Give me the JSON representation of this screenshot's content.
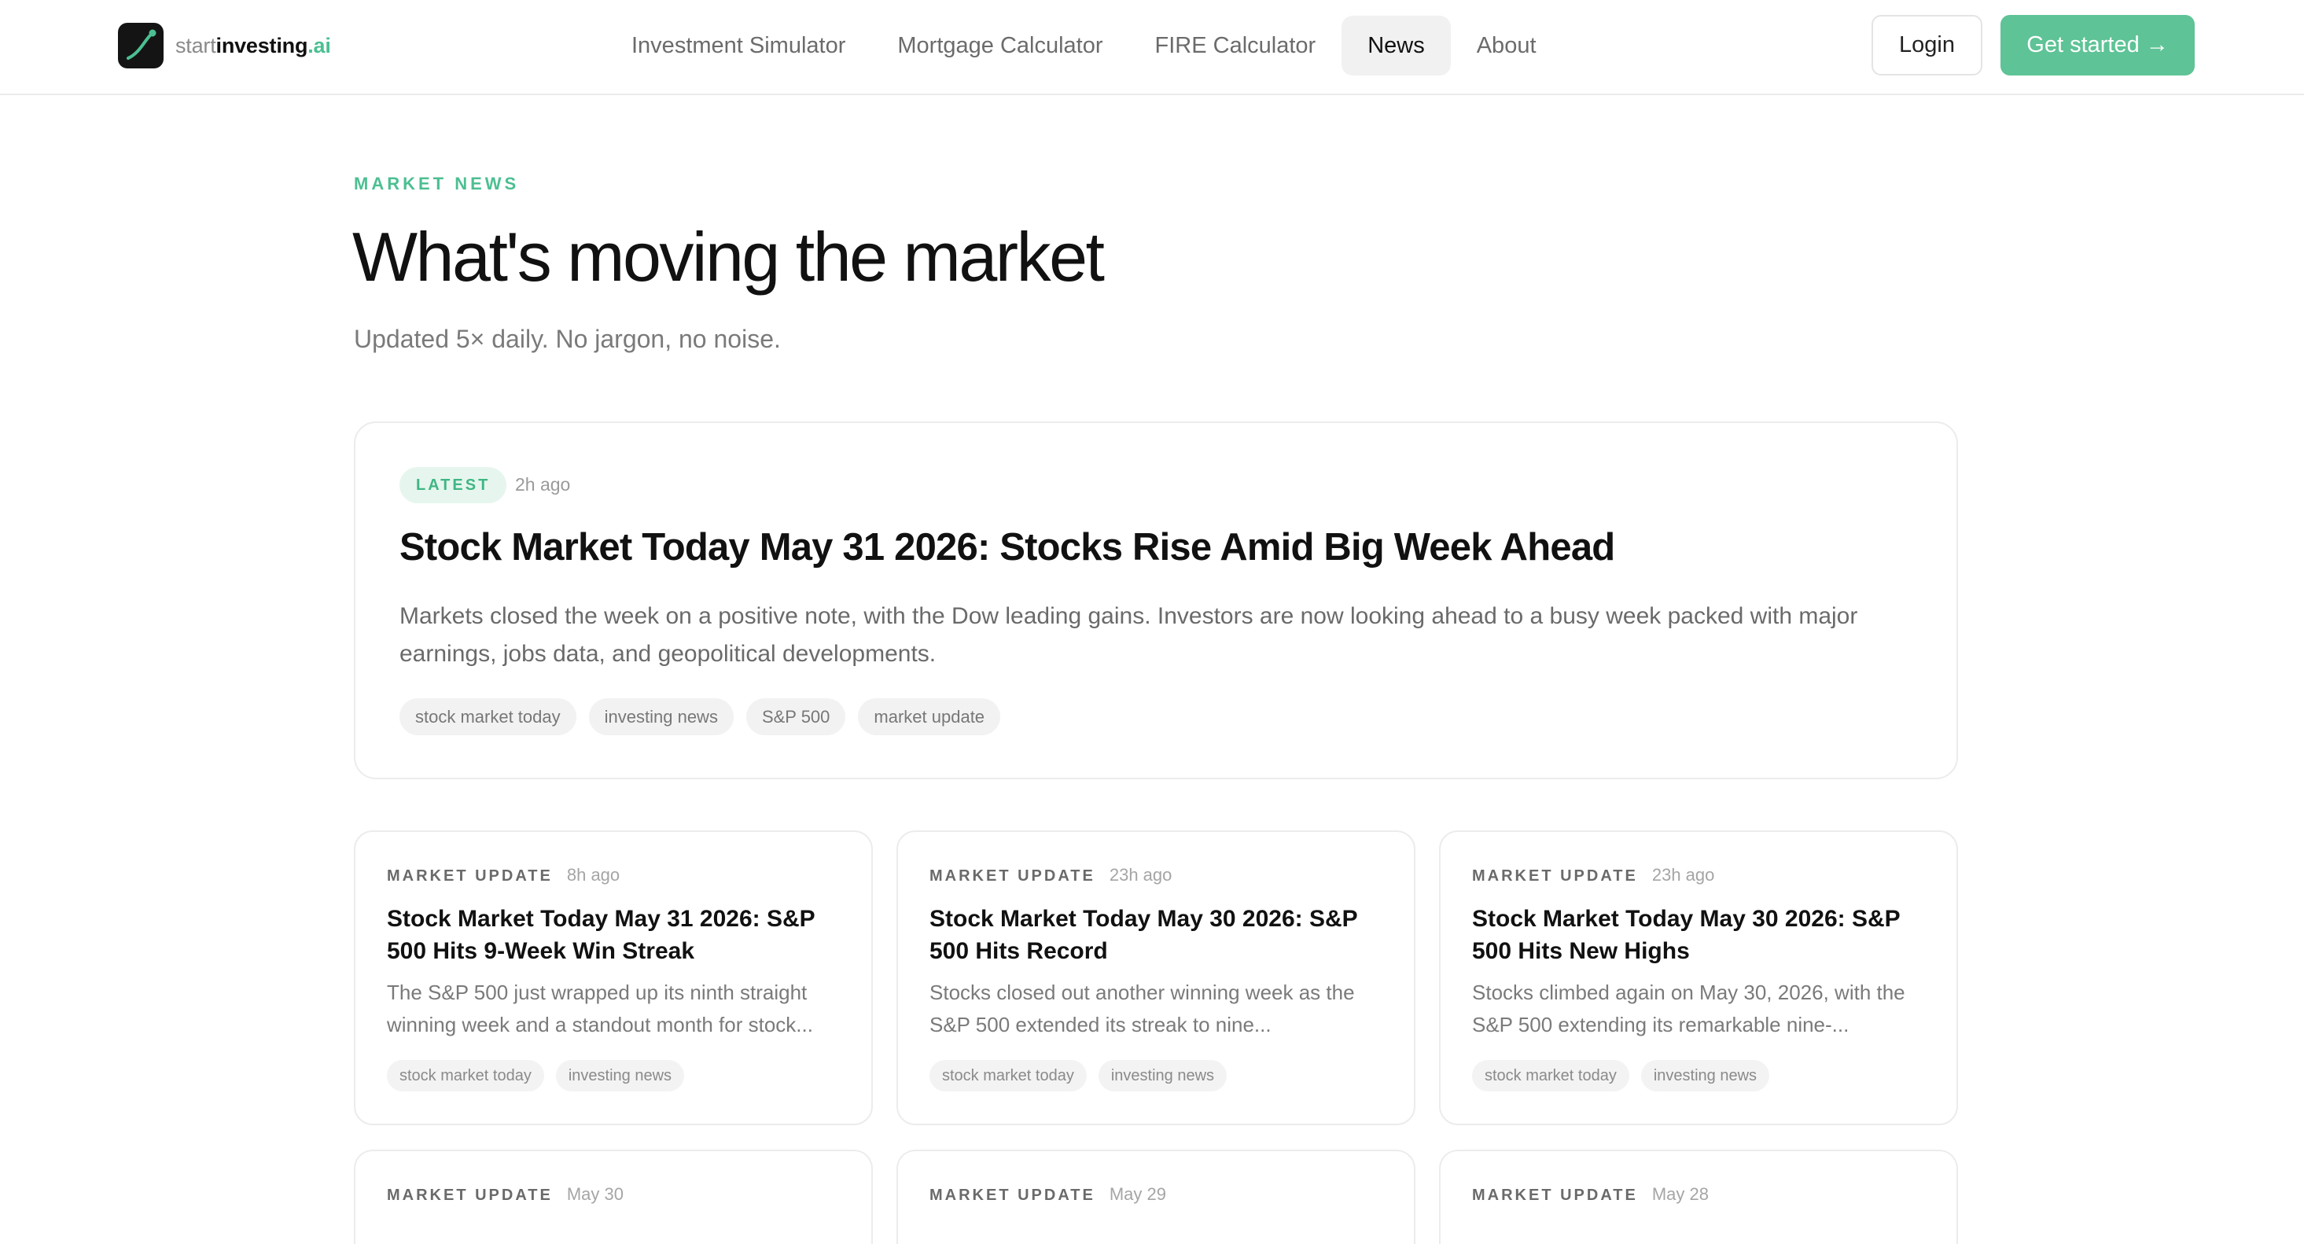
{
  "brand": {
    "part1": "start",
    "part2": "investing",
    "part3": ".ai",
    "accent": "#5ec396"
  },
  "nav": {
    "items": [
      {
        "label": "Investment Simulator"
      },
      {
        "label": "Mortgage Calculator"
      },
      {
        "label": "FIRE Calculator"
      },
      {
        "label": "News",
        "active": true
      },
      {
        "label": "About"
      }
    ],
    "login_label": "Login",
    "cta_label": "Get started",
    "cta_arrow": "→"
  },
  "hero": {
    "eyebrow": "MARKET NEWS",
    "title": "What's moving the market",
    "subtitle": "Updated 5× daily. No jargon, no noise."
  },
  "featured": {
    "badge": "LATEST",
    "time": "2h ago",
    "title": "Stock Market Today May 31 2026: Stocks Rise Amid Big Week Ahead",
    "excerpt": "Markets closed the week on a positive note, with the Dow leading gains. Investors are now looking ahead to a busy week packed with major earnings, jobs data, and geopolitical developments.",
    "tags": [
      "stock market today",
      "investing news",
      "S&P 500",
      "market update"
    ]
  },
  "cards": [
    {
      "category": "MARKET UPDATE",
      "time": "8h ago",
      "title": "Stock Market Today May 31 2026: S&P 500 Hits 9-Week Win Streak",
      "excerpt": "The S&P 500 just wrapped up its ninth straight winning week and a standout month for stock...",
      "tags": [
        "stock market today",
        "investing news"
      ]
    },
    {
      "category": "MARKET UPDATE",
      "time": "23h ago",
      "title": "Stock Market Today May 30 2026: S&P 500 Hits Record",
      "excerpt": "Stocks closed out another winning week as the S&P 500 extended its streak to nine...",
      "tags": [
        "stock market today",
        "investing news"
      ]
    },
    {
      "category": "MARKET UPDATE",
      "time": "23h ago",
      "title": "Stock Market Today May 30 2026: S&P 500 Hits New Highs",
      "excerpt": "Stocks climbed again on May 30, 2026, with the S&P 500 extending its remarkable nine-...",
      "tags": [
        "stock market today",
        "investing news"
      ]
    },
    {
      "category": "MARKET UPDATE",
      "time": "May 30"
    },
    {
      "category": "MARKET UPDATE",
      "time": "May 29"
    },
    {
      "category": "MARKET UPDATE",
      "time": "May 28"
    }
  ]
}
